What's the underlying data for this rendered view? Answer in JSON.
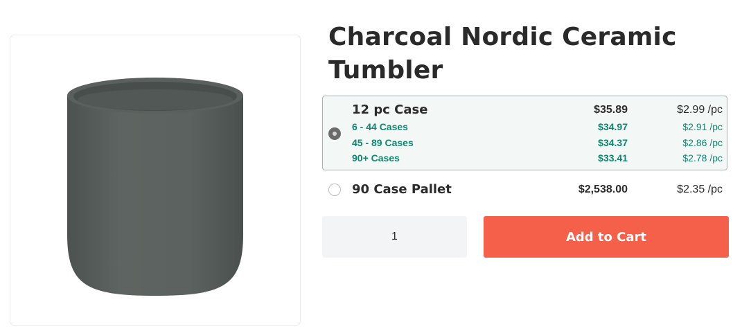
{
  "product": {
    "title": "Charcoal Nordic Ceramic Tumbler",
    "image_alt": "Charcoal ceramic tumbler"
  },
  "options": [
    {
      "name": "12 pc Case",
      "price": "$35.89",
      "unit_price": "$2.99 /pc",
      "selected": true,
      "tiers": [
        {
          "label": "6 - 44 Cases",
          "price": "$34.97",
          "unit_price": "$2.91 /pc"
        },
        {
          "label": "45 - 89 Cases",
          "price": "$34.37",
          "unit_price": "$2.86 /pc"
        },
        {
          "label": "90+ Cases",
          "price": "$33.41",
          "unit_price": "$2.78 /pc"
        }
      ]
    },
    {
      "name": "90 Case Pallet",
      "price": "$2,538.00",
      "unit_price": "$2.35 /pc",
      "selected": false
    }
  ],
  "quantity": {
    "value": "1"
  },
  "cart": {
    "button_label": "Add to Cart"
  },
  "colors": {
    "accent": "#f5604a",
    "tier_green": "#0f8770",
    "selected_bg": "#f3f7f5",
    "tumbler": "#5a605d"
  }
}
